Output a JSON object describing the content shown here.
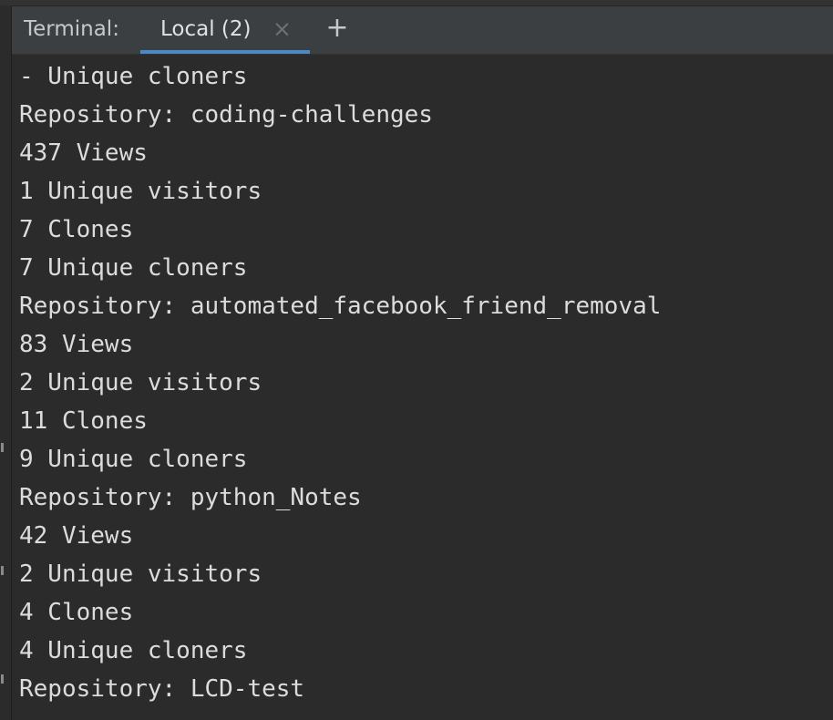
{
  "tabbar": {
    "title": "Terminal:",
    "tabs": [
      {
        "label": "Local (2)",
        "close_icon": "×",
        "active": true
      }
    ],
    "add_icon": "+"
  },
  "colors": {
    "background": "#2b2b2b",
    "tabbar": "#3c3f41",
    "text": "#dcdcdc",
    "tab_underline": "#4a88c7"
  },
  "terminal": {
    "lines": [
      "- Unique cloners",
      "Repository: coding-challenges",
      "437 Views",
      "1 Unique visitors",
      "7 Clones",
      "7 Unique cloners",
      "Repository: automated_facebook_friend_removal",
      "83 Views",
      "2 Unique visitors",
      "11 Clones",
      "9 Unique cloners",
      "Repository: python_Notes",
      "42 Views",
      "2 Unique visitors",
      "4 Clones",
      "4 Unique cloners",
      "Repository: LCD-test"
    ]
  }
}
